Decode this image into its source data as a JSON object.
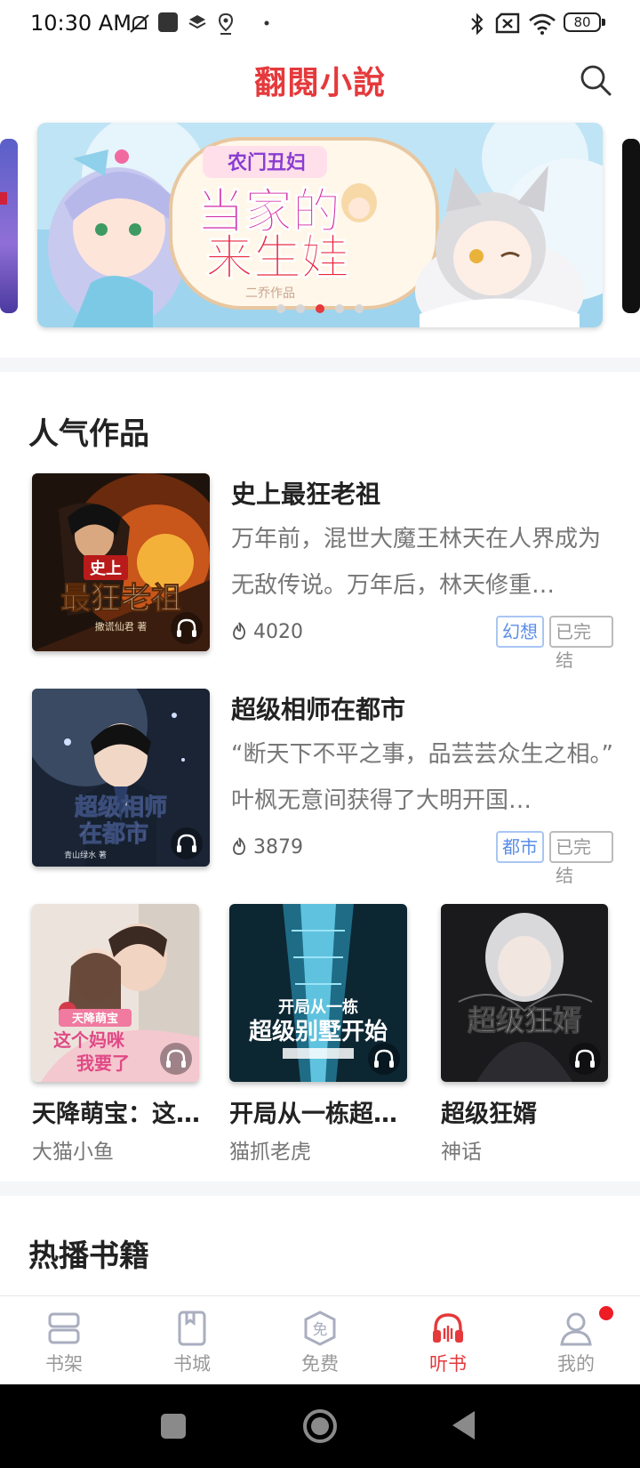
{
  "status_bar": {
    "time": "10:30 AM",
    "battery": "80"
  },
  "app": {
    "title": "翻閱小說"
  },
  "banner": {
    "line1": "农门丑妇",
    "line2": "当家的",
    "line3": "来生娃",
    "credit": "二乔作品",
    "dot_count": 5,
    "active_dot": 2
  },
  "sections": {
    "popular_title": "人气作品",
    "hot_title": "热播书籍"
  },
  "featured_books": [
    {
      "title": "史上最狂老祖",
      "description": "万年前，混世大魔王林天在人界成为无敌传说。万年后，林天修重…",
      "heat": "4020",
      "genre": "幻想",
      "status": "已完结",
      "cover_text": "史上最狂老祖",
      "cover_author": "撒谎仙君 著"
    },
    {
      "title": "超级相师在都市",
      "description": "“断天下不平之事，品芸芸众生之相。” 叶枫无意间获得了大明开国…",
      "heat": "3879",
      "genre": "都市",
      "status": "已完结",
      "cover_text": "超级相师在都市",
      "cover_author": "青山绿水 著"
    }
  ],
  "grid_books": [
    {
      "title": "天降萌宝：这…",
      "author": "大猫小鱼",
      "cover_tag": "天降萌宝",
      "cover_text": "这个妈咪我要了"
    },
    {
      "title": "开局从一栋超…",
      "author": "猫抓老虎",
      "cover_tag": "开局从一栋",
      "cover_text": "超级别墅开始"
    },
    {
      "title": "超级狂婿",
      "author": "神话",
      "cover_tag": "",
      "cover_text": "超级狂婿"
    }
  ],
  "bottom_nav": [
    {
      "label": "书架",
      "icon": "bookshelf-icon"
    },
    {
      "label": "书城",
      "icon": "bookstore-icon"
    },
    {
      "label": "免费",
      "icon": "free-icon",
      "glyph": "免"
    },
    {
      "label": "听书",
      "icon": "headphones-icon",
      "active": true
    },
    {
      "label": "我的",
      "icon": "profile-icon",
      "badge": true
    }
  ],
  "colors": {
    "accent": "#e5393c",
    "tag_blue": "#5b8ee8",
    "muted": "#999999"
  }
}
